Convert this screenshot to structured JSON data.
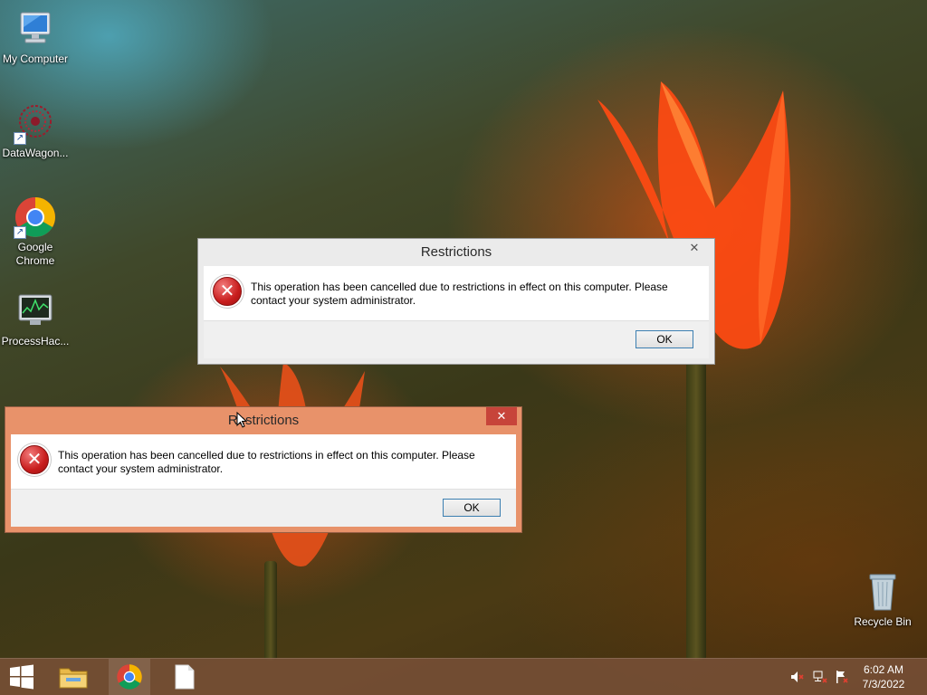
{
  "desktop_icons": [
    {
      "label": "My Computer",
      "icon": "computer-icon"
    },
    {
      "label": "DataWagon...",
      "icon": "datawagon-icon"
    },
    {
      "label": "Google Chrome",
      "icon": "chrome-icon"
    },
    {
      "label": "ProcessHac...",
      "icon": "process-hacker-icon"
    },
    {
      "label": "Recycle Bin",
      "icon": "recycle-bin-icon"
    }
  ],
  "dialogs": [
    {
      "title": "Restrictions",
      "close_label": "✕",
      "message": "This operation has been cancelled due to restrictions in effect on this computer. Please contact your system administrator.",
      "ok_label": "OK",
      "state": "inactive"
    },
    {
      "title": "Restrictions",
      "close_label": "✕",
      "message": "This operation has been cancelled due to restrictions in effect on this computer. Please contact your system administrator.",
      "ok_label": "OK",
      "state": "active"
    }
  ],
  "taskbar": {
    "pinned": [
      {
        "icon": "windows-start-icon"
      },
      {
        "icon": "file-explorer-icon"
      },
      {
        "icon": "chrome-icon"
      },
      {
        "icon": "blank-document-icon"
      }
    ],
    "tray": [
      {
        "icon": "volume-muted-icon"
      },
      {
        "icon": "network-icon"
      },
      {
        "icon": "action-center-flag-icon"
      }
    ],
    "clock": {
      "time": "6:02 AM",
      "date": "7/3/2022"
    }
  },
  "colors": {
    "active_titlebar": "#e8926a",
    "inactive_titlebar": "#ebebeb",
    "close_active": "#c7443a",
    "error_red": "#c81d1d",
    "taskbar": "#78503a"
  }
}
